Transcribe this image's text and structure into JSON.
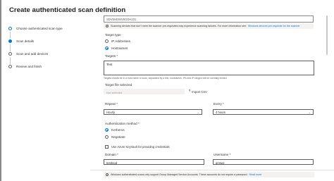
{
  "title": "Create authenticated scan definition",
  "steps": [
    {
      "label": "Choose authenticated scan type",
      "state": "done"
    },
    {
      "label": "Scan details",
      "state": "active"
    },
    {
      "label": "Scan and add devices",
      "state": "pending"
    },
    {
      "label": "Review and finish",
      "state": "pending"
    }
  ],
  "form": {
    "top_field_value": "SDV5HDWV5GDH231",
    "top_banner_text": "Scanning devices that don't meet the scanner pre-requisites may experience scanning failures. For more information see:",
    "top_banner_link": "Windows devices pre-requisite for the scanner",
    "target_type_label": "Target type",
    "target_type_options": [
      {
        "label": "IP Addresses",
        "selected": false
      },
      {
        "label": "Hostnames",
        "selected": true
      }
    ],
    "targets_label": "Targets *",
    "targets_value": "Test",
    "targets_hint": "Targets should be in a host name to scan, separated by a line, hostnames, IPs and IP ranges will be normally limited",
    "target_file_label": "Target file selected",
    "target_file_placeholder": "Not selected",
    "import_label": "Import CSV",
    "repeat_label": "Repeat *",
    "repeat_value": "Hourly",
    "every_label": "Every *",
    "every_value": "4 hours",
    "auth_method_label": "Authentication method *",
    "auth_methods": [
      {
        "label": "Kerberos",
        "selected": true
      },
      {
        "label": "Negotiate",
        "selected": false
      }
    ],
    "keyvault_label": "Use Azure KeyVault for providing credentials",
    "domain_label": "Domain *",
    "domain_value": "testlocal",
    "username_label": "Username *",
    "username_value": "gmsa1",
    "footer_banner_text": "Windows authenticated scans only support Group Managed Service Accounts. These accounts do not require a password.",
    "footer_banner_link": "Read more"
  },
  "colors": {
    "accent": "#0078d4",
    "banner_bg": "#f3f2f1"
  }
}
